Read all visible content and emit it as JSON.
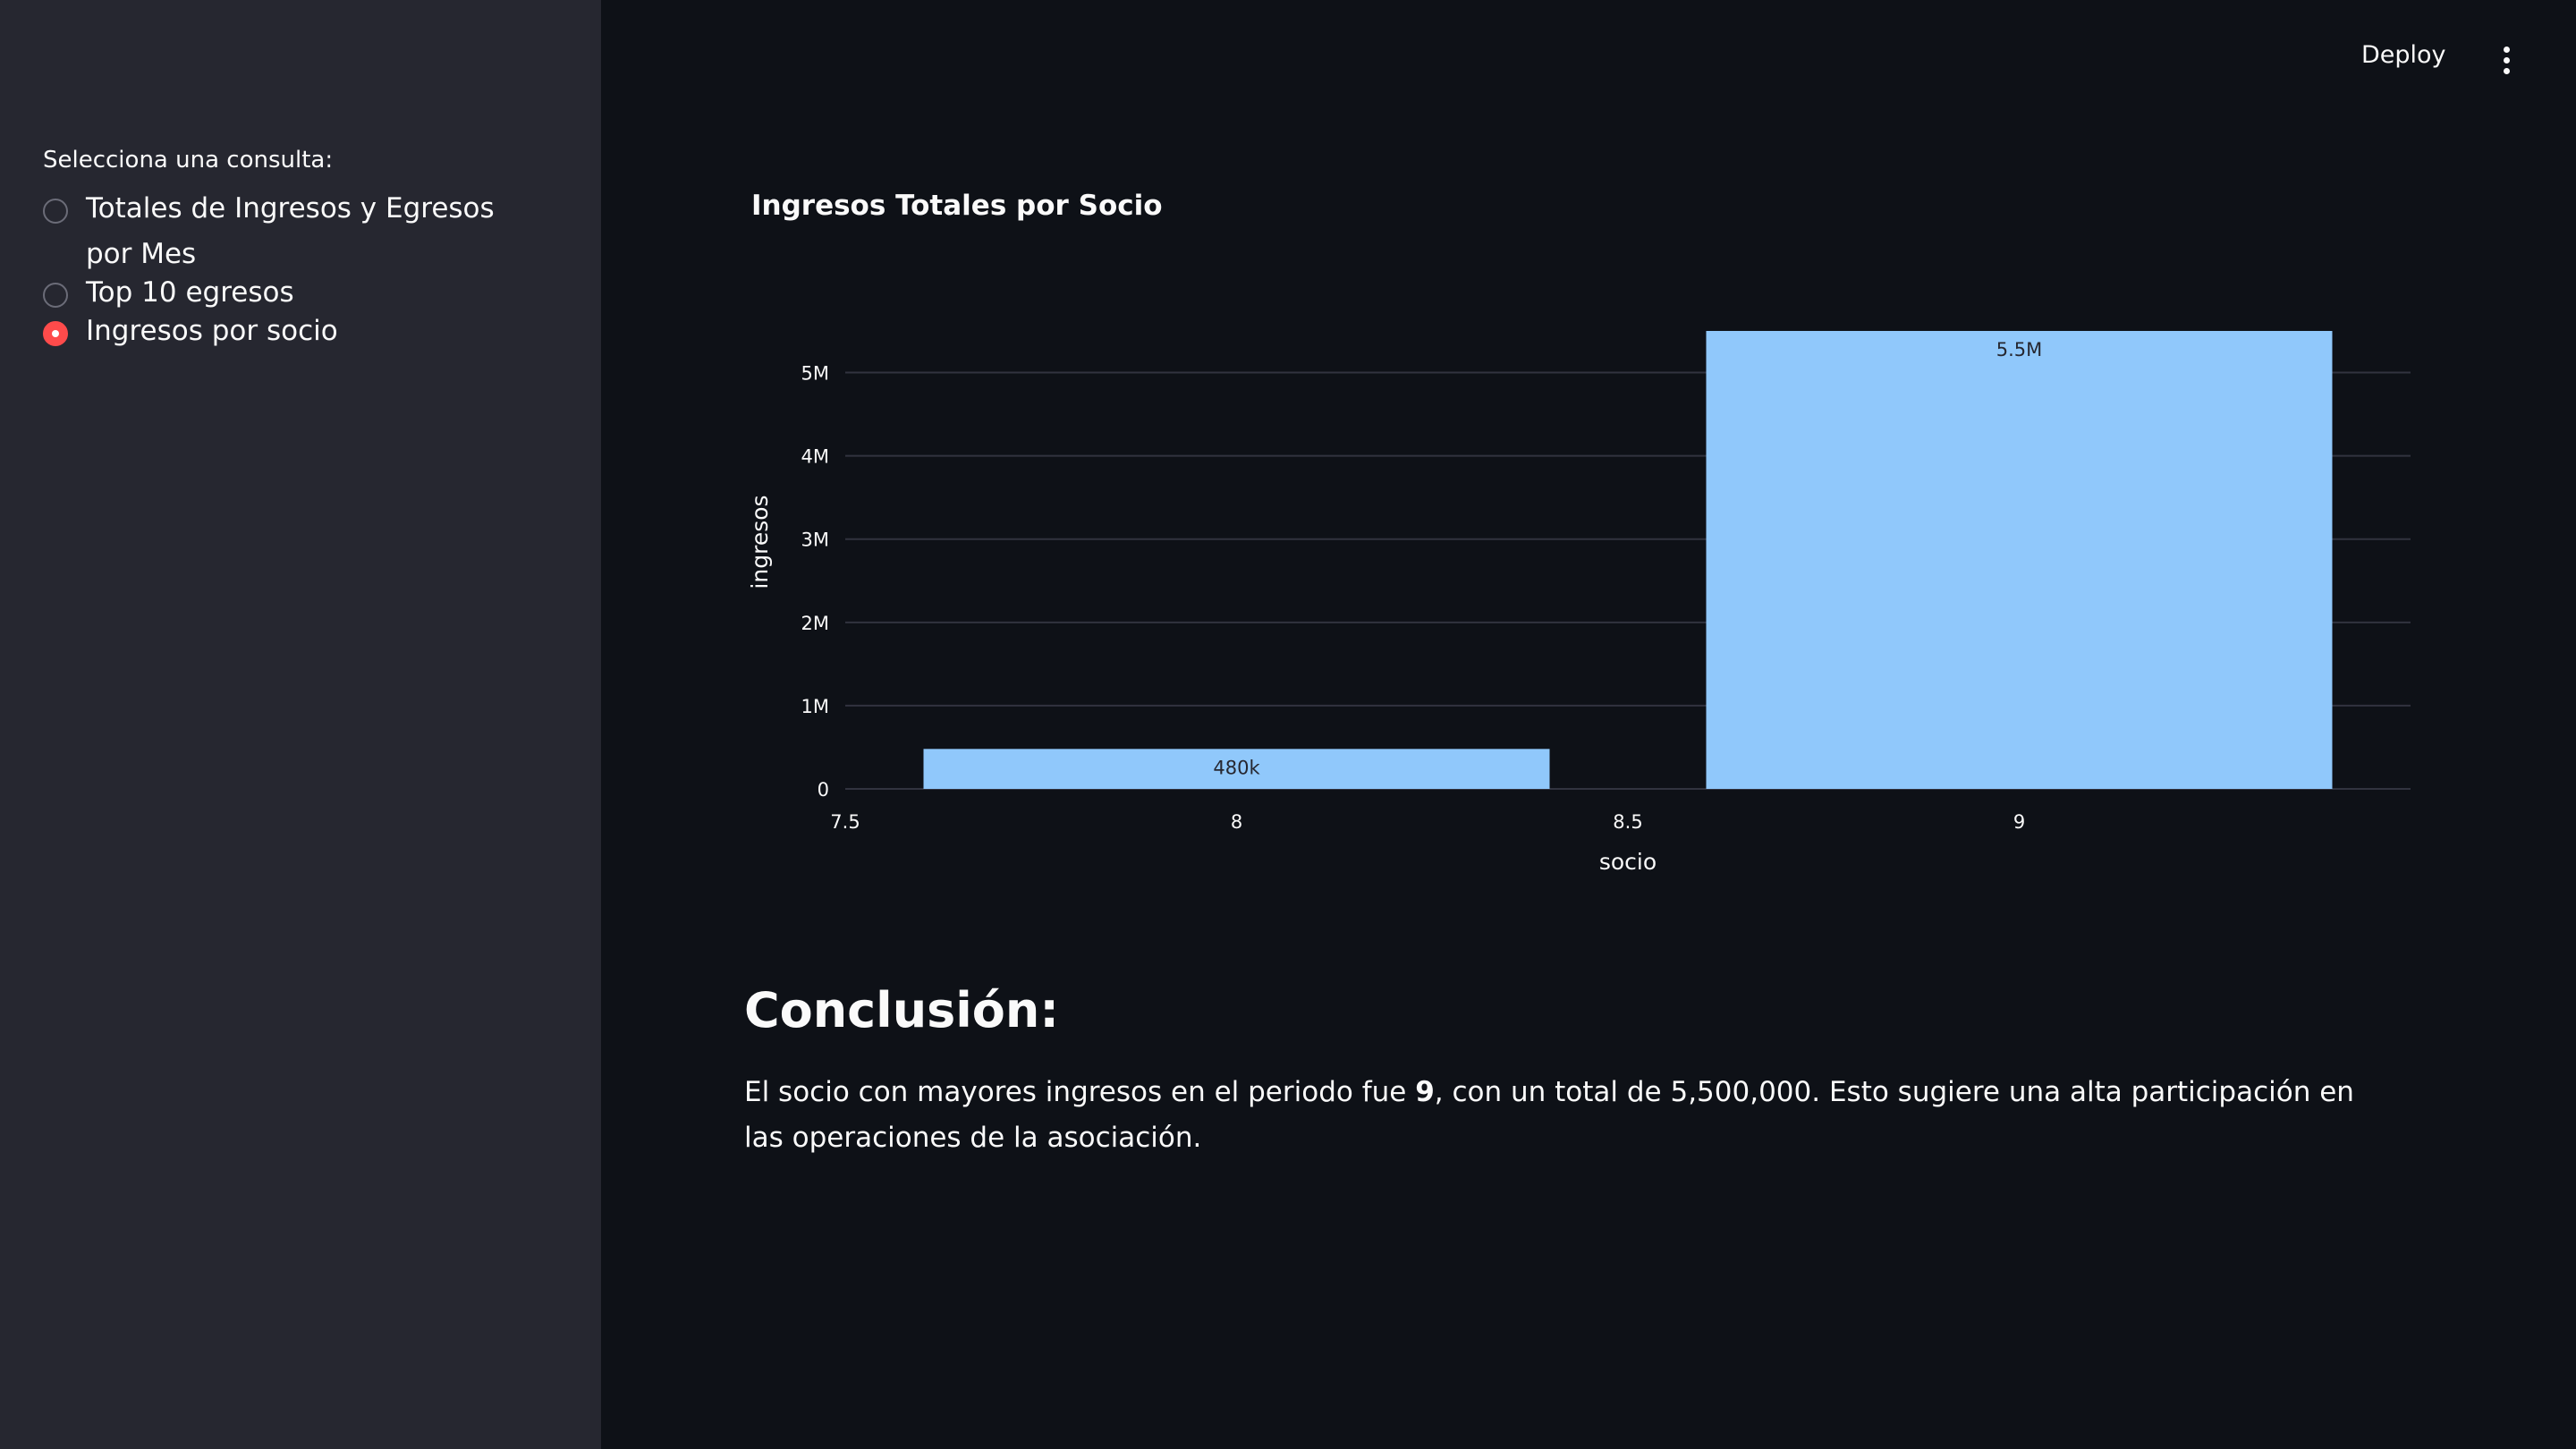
{
  "header": {
    "deploy_label": "Deploy",
    "menu_icon": "more-vertical-icon"
  },
  "sidebar": {
    "label": "Selecciona una consulta:",
    "options": [
      {
        "label": "Totales de Ingresos y Egresos por Mes",
        "selected": false
      },
      {
        "label": "Top 10 egresos",
        "selected": false
      },
      {
        "label": "Ingresos por socio",
        "selected": true
      }
    ],
    "accent_color": "#ff4b4b"
  },
  "chart_data": {
    "type": "bar",
    "title": "Ingresos Totales por Socio",
    "xlabel": "socio",
    "ylabel": "ingresos",
    "x": [
      8,
      9
    ],
    "values": [
      480000,
      5500000
    ],
    "bar_labels": [
      "480k",
      "5.5M"
    ],
    "xlim": [
      7.5,
      9.5
    ],
    "ylim": [
      0,
      5500000
    ],
    "x_ticks": [
      {
        "value": 7.5,
        "label": "7.5"
      },
      {
        "value": 8,
        "label": "8"
      },
      {
        "value": 8.5,
        "label": "8.5"
      },
      {
        "value": 9,
        "label": "9"
      }
    ],
    "y_ticks": [
      {
        "value": 0,
        "label": "0"
      },
      {
        "value": 1000000,
        "label": "1M"
      },
      {
        "value": 2000000,
        "label": "2M"
      },
      {
        "value": 3000000,
        "label": "3M"
      },
      {
        "value": 4000000,
        "label": "4M"
      },
      {
        "value": 5000000,
        "label": "5M"
      }
    ],
    "grid": true,
    "bar_color": "#90c8fb"
  },
  "conclusion": {
    "heading": "Conclusión:",
    "text_before": "El socio con mayores ingresos en el periodo fue ",
    "bold_value": "9",
    "text_after": ", con un total de 5,500,000. Esto sugiere una alta participación en las operaciones de la asociación."
  }
}
